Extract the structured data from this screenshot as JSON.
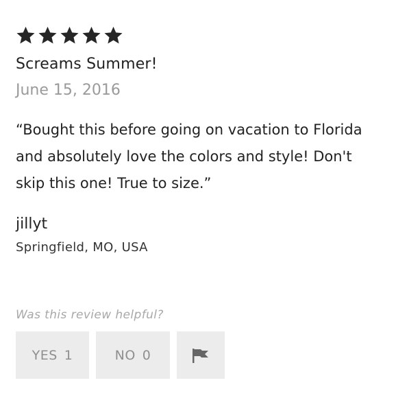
{
  "review": {
    "rating": 5,
    "rating_max": 5,
    "title": "Screams Summer!",
    "date": "June 15, 2016",
    "body": "“Bought this before going on vacation to Florida and absolutely love the colors and style! Don't skip this one! True to size.”",
    "author": "jillyt",
    "location": "Springfield, MO, USA"
  },
  "helpful": {
    "question": "Was this review helpful?",
    "yes_label": "YES",
    "yes_count": "1",
    "no_label": "NO",
    "no_count": "0"
  },
  "icons": {
    "star": "star-icon",
    "flag": "flag-icon"
  },
  "colors": {
    "text": "#222222",
    "muted": "#9a9a9a",
    "button_bg": "#ececec",
    "button_text": "#8f8f8f"
  }
}
